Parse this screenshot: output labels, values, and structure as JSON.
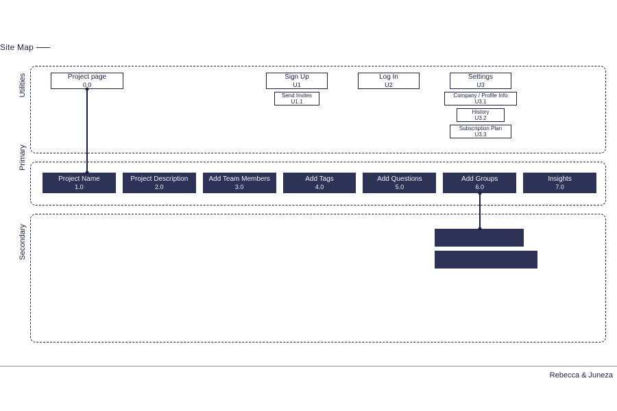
{
  "title": "Site Map",
  "sections": {
    "utilities": "Utilities",
    "primary": "Primary",
    "secondary": "Secondary"
  },
  "utilities": {
    "project_page": {
      "name": "Project page",
      "code": "0.0"
    },
    "sign_up": {
      "name": "Sign Up",
      "code": "U1"
    },
    "send_invites": {
      "name": "Send Invites",
      "code": "U1.1"
    },
    "log_in": {
      "name": "Log In",
      "code": "U2"
    },
    "settings": {
      "name": "Settings",
      "code": "U3"
    },
    "company_info": {
      "name": "Company / Profile Info",
      "code": "U3.1"
    },
    "history": {
      "name": "History",
      "code": "U3.2"
    },
    "sub_plan": {
      "name": "Subscription Plan",
      "code": "U3.3"
    }
  },
  "primary": [
    {
      "name": "Project Name",
      "code": "1.0"
    },
    {
      "name": "Project Description",
      "code": "2.0"
    },
    {
      "name": "Add Team Members",
      "code": "3.0"
    },
    {
      "name": "Add Tags",
      "code": "4.0"
    },
    {
      "name": "Add Questions",
      "code": "5.0"
    },
    {
      "name": "Add Groups",
      "code": "6.0"
    },
    {
      "name": "Insights",
      "code": "7.0"
    }
  ],
  "secondary": [
    {
      "name": "",
      "code": ""
    },
    {
      "name": "",
      "code": ""
    }
  ],
  "footer": "Rebecca & Juneza"
}
